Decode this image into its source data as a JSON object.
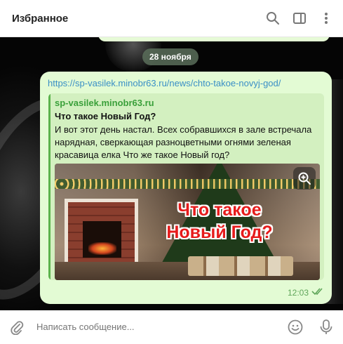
{
  "header": {
    "title": "Избранное",
    "icons": [
      "search-icon",
      "sidebar-toggle-icon",
      "more-vertical-icon"
    ]
  },
  "chat": {
    "date_label": "28 ноября",
    "message": {
      "link_text": "https://sp-vasilek.minobr63.ru/news/chto-takoe-novyj-god/",
      "preview": {
        "site_name": "sp-vasilek.minobr63.ru",
        "title": "Что такое Новый Год?",
        "description": "И вот этот день настал. Всех собравшихся в зале встречала нарядная, сверкающая разноцветными огнями зеленая красавица елка Что же такое Новый год?",
        "image_text_line1": "Что такое",
        "image_text_line2": "Новый Год?"
      },
      "time": "12:03",
      "status_icon": "double-check-icon"
    }
  },
  "composer": {
    "placeholder": "Написать сообщение...",
    "icons": [
      "attach-icon",
      "emoji-icon",
      "microphone-icon"
    ]
  },
  "colors": {
    "bubble": "#e3fbd4",
    "link": "#3a8fc6",
    "site": "#3aa03a",
    "overlay_red": "#e61b1b"
  }
}
